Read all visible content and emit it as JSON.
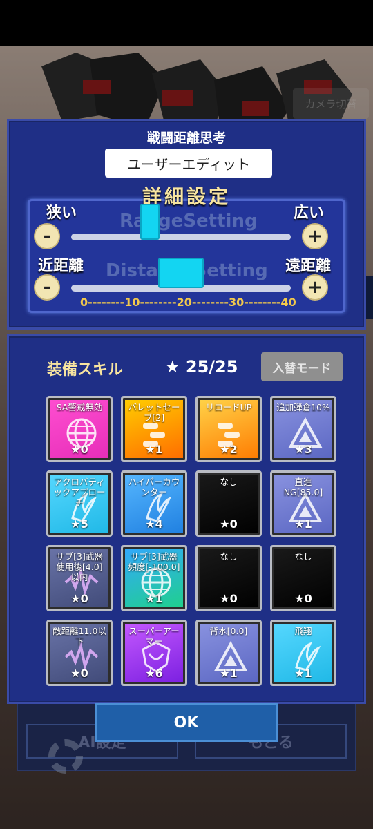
{
  "background": {
    "camera_button": "カメラ切替",
    "ai_settings_label": "AI設定",
    "back_label": "もどる"
  },
  "distance_panel": {
    "title": "戦闘距離思考",
    "preset_value": "ユーザーエディット",
    "detail_title": "詳細設定",
    "range_row": {
      "left_label": "狭い",
      "right_label": "広い",
      "ghost_text": "RangeSetting",
      "minus": "-",
      "plus": "+",
      "value_fraction": 0.36
    },
    "distance_row": {
      "left_label": "近距離",
      "right_label": "遠距離",
      "ghost_text": "DistanceSetting",
      "minus": "-",
      "plus": "+",
      "value": 20
    },
    "scale_text": "0--------10--------20--------30--------40"
  },
  "skills_panel": {
    "title": "装備スキル",
    "stars_text": "★ 25/25",
    "mode_button": "入替モード",
    "skills": [
      {
        "name": "SA警戒無効",
        "cost": "★0",
        "color": "#e62db8",
        "color2": "#ff4fd1",
        "icon": "globe-icon"
      },
      {
        "name": "バレットセーブ[2]",
        "cost": "★1",
        "color": "#ff6a00",
        "color2": "#ffd000",
        "icon": "bullet-icon"
      },
      {
        "name": "リロードUP",
        "cost": "★2",
        "color": "#ff7a00",
        "color2": "#ffd54a",
        "icon": "bullet-icon"
      },
      {
        "name": "追加弾倉10%",
        "cost": "★3",
        "color": "#5a66c2",
        "color2": "#8a93e0",
        "icon": "triangle-icon"
      },
      {
        "name": "アクロバティックアプローチ",
        "cost": "★5",
        "color": "#1fb8e6",
        "color2": "#57d8ff",
        "icon": "claw-icon"
      },
      {
        "name": "ハイパーカウンター",
        "cost": "★4",
        "color": "#1f7fe0",
        "color2": "#57b8ff",
        "icon": "claw-icon"
      },
      {
        "name": "なし",
        "cost": "★0",
        "color": "#000000",
        "color2": "#1a1a1a",
        "icon": "empty-icon"
      },
      {
        "name": "直進NG[85.0]",
        "cost": "★1",
        "color": "#5a66c2",
        "color2": "#8a93e0",
        "icon": "triangle-icon"
      },
      {
        "name": "サブ[3]武器使用後[4.0]以内",
        "cost": "★0",
        "color": "#404a78",
        "color2": "#6a74a8",
        "icon": "wave-icon"
      },
      {
        "name": "サブ[3]武器頻度[-100.0]",
        "cost": "★1",
        "color": "#1fd18a",
        "color2": "#33a8ff",
        "icon": "globe-icon"
      },
      {
        "name": "なし",
        "cost": "★0",
        "color": "#000000",
        "color2": "#1a1a1a",
        "icon": "empty-icon"
      },
      {
        "name": "なし",
        "cost": "★0",
        "color": "#000000",
        "color2": "#1a1a1a",
        "icon": "empty-icon"
      },
      {
        "name": "敵距離11.0以下",
        "cost": "★0",
        "color": "#404a78",
        "color2": "#6a74a8",
        "icon": "wave-icon"
      },
      {
        "name": "スーパーアーマー",
        "cost": "★6",
        "color": "#7a1fe0",
        "color2": "#c65aff",
        "icon": "shield-icon"
      },
      {
        "name": "背水[0.0]",
        "cost": "★1",
        "color": "#5a66c2",
        "color2": "#8a93e0",
        "icon": "triangle-icon"
      },
      {
        "name": "飛翔",
        "cost": "★1",
        "color": "#1fb8e6",
        "color2": "#57d8ff",
        "icon": "claw-icon"
      }
    ]
  },
  "ok_button": "OK",
  "side_arrow": "❬"
}
